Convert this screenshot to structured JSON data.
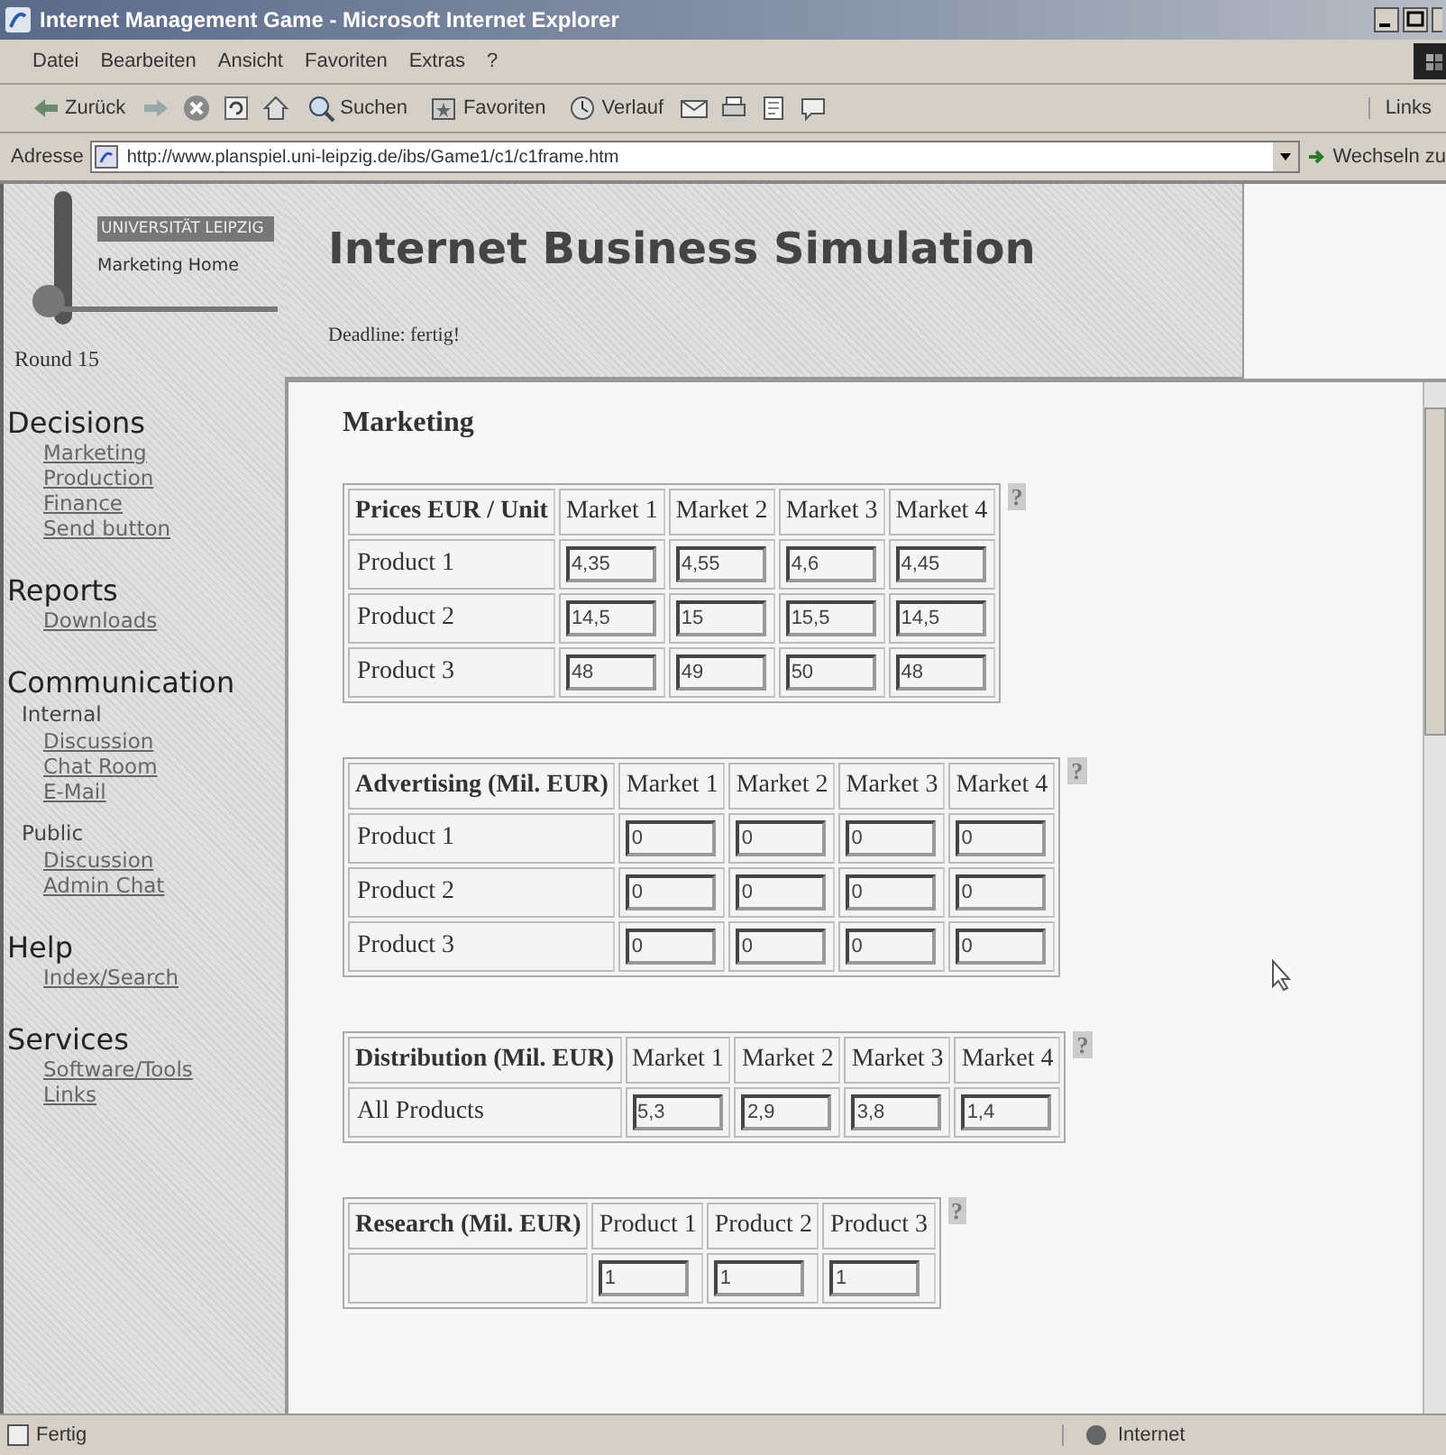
{
  "window": {
    "title": "Internet Management Game - Microsoft Internet Explorer"
  },
  "menu": [
    "Datei",
    "Bearbeiten",
    "Ansicht",
    "Favoriten",
    "Extras",
    "?"
  ],
  "toolbar": [
    {
      "kind": "back",
      "label": "Zurück"
    },
    {
      "kind": "forward"
    },
    {
      "kind": "stop"
    },
    {
      "kind": "refresh"
    },
    {
      "kind": "home"
    },
    {
      "kind": "search",
      "label": "Suchen"
    },
    {
      "kind": "favorites",
      "label": "Favoriten"
    },
    {
      "kind": "history",
      "label": "Verlauf"
    },
    {
      "kind": "mail"
    },
    {
      "kind": "print"
    },
    {
      "kind": "edit"
    },
    {
      "kind": "discuss"
    }
  ],
  "links_label": "Links",
  "address": {
    "label": "Adresse",
    "url": "http://www.planspiel.uni-leipzig.de/ibs/Game1/c1/c1frame.htm",
    "go": "Wechseln zu"
  },
  "sidebar": {
    "logo_top": "UNIVERSITÄT LEIPZIG",
    "logo_link": "Marketing Home",
    "round": "Round 15",
    "sections": [
      {
        "heading": "Decisions",
        "items": [
          {
            "kind": "link",
            "text": "Marketing"
          },
          {
            "kind": "link",
            "text": "Production"
          },
          {
            "kind": "link",
            "text": "Finance"
          },
          {
            "kind": "link",
            "text": "Send button"
          }
        ]
      },
      {
        "heading": "Reports",
        "items": [
          {
            "kind": "link",
            "text": "Downloads"
          }
        ]
      },
      {
        "heading": "Communication",
        "items": [
          {
            "kind": "group",
            "text": "Internal"
          },
          {
            "kind": "link",
            "text": "Discussion"
          },
          {
            "kind": "link",
            "text": "Chat Room"
          },
          {
            "kind": "link",
            "text": "E-Mail"
          },
          {
            "kind": "group",
            "text": "Public"
          },
          {
            "kind": "link",
            "text": "Discussion"
          },
          {
            "kind": "link",
            "text": "Admin Chat"
          }
        ]
      },
      {
        "heading": "Help",
        "items": [
          {
            "kind": "link",
            "text": "Index/Search"
          }
        ]
      },
      {
        "heading": "Services",
        "items": [
          {
            "kind": "link",
            "text": "Software/Tools"
          },
          {
            "kind": "link",
            "text": "Links"
          }
        ]
      }
    ]
  },
  "header": {
    "title": "Internet Business Simulation",
    "deadline": "Deadline: fertig!"
  },
  "main": {
    "heading": "Marketing",
    "tables": [
      {
        "columns": [
          "Prices EUR / Unit",
          "Market 1",
          "Market 2",
          "Market 3",
          "Market 4"
        ],
        "help": "?",
        "rows": [
          {
            "label": "Product 1",
            "values": [
              "4,35",
              "4,55",
              "4,6",
              "4,45"
            ]
          },
          {
            "label": "Product 2",
            "values": [
              "14,5",
              "15",
              "15,5",
              "14,5"
            ]
          },
          {
            "label": "Product 3",
            "values": [
              "48",
              "49",
              "50",
              "48"
            ]
          }
        ]
      },
      {
        "columns": [
          "Advertising (Mil. EUR)",
          "Market 1",
          "Market 2",
          "Market 3",
          "Market 4"
        ],
        "help": "?",
        "rows": [
          {
            "label": "Product 1",
            "values": [
              "0",
              "0",
              "0",
              "0"
            ]
          },
          {
            "label": "Product 2",
            "values": [
              "0",
              "0",
              "0",
              "0"
            ]
          },
          {
            "label": "Product 3",
            "values": [
              "0",
              "0",
              "0",
              "0"
            ]
          }
        ]
      },
      {
        "columns": [
          "Distribution (Mil. EUR)",
          "Market 1",
          "Market 2",
          "Market 3",
          "Market 4"
        ],
        "help": "?",
        "rows": [
          {
            "label": "All Products",
            "values": [
              "5,3",
              "2,9",
              "3,8",
              "1,4"
            ]
          }
        ]
      },
      {
        "columns": [
          "Research (Mil. EUR)",
          "Product 1",
          "Product 2",
          "Product 3"
        ],
        "help": "?",
        "rows": [
          {
            "values": [
              "1",
              "1",
              "1"
            ]
          }
        ]
      }
    ]
  },
  "status": {
    "text": "Fertig",
    "zone": "Internet"
  }
}
